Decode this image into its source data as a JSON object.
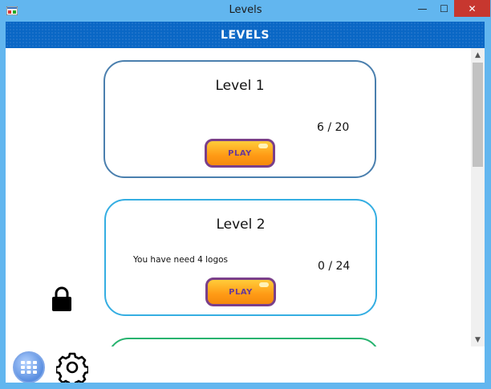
{
  "window": {
    "title": "Levels",
    "minimize_glyph": "—",
    "maximize_glyph": "☐",
    "close_glyph": "✕"
  },
  "header": {
    "title": "LEVELS"
  },
  "levels": [
    {
      "title": "Level 1",
      "score": "6  /  20",
      "note": "",
      "play_label": "PLAY",
      "locked": false,
      "border_color": "#4a7fae"
    },
    {
      "title": "Level 2",
      "score": "0  /  24",
      "note": "You have need 4 logos",
      "play_label": "PLAY",
      "locked": true,
      "border_color": "#35aee2"
    }
  ],
  "scrollbar": {
    "up_glyph": "▲",
    "down_glyph": "▼"
  },
  "icons": {
    "app": "app-icon",
    "lock": "lock-icon",
    "menu": "grid-icon",
    "settings": "gear-icon"
  },
  "colors": {
    "header": "#0a67c5",
    "play_button": "#ff9a15",
    "play_border": "#7a3f8a",
    "close_button": "#c7372f"
  }
}
